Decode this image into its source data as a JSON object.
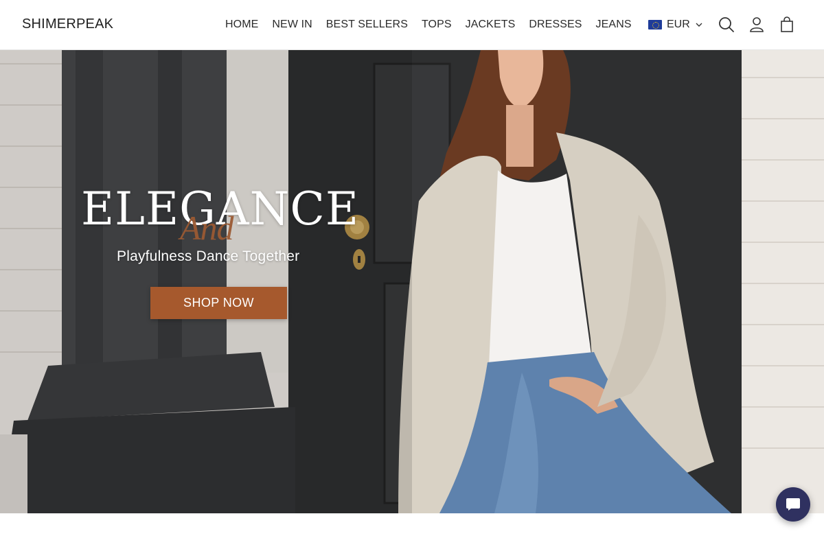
{
  "brand": {
    "logo_text": "SHIMERPEAK"
  },
  "nav": {
    "items": [
      {
        "label": "HOME"
      },
      {
        "label": "NEW IN"
      },
      {
        "label": "BEST SELLERS"
      },
      {
        "label": "TOPS"
      },
      {
        "label": "JACKETS"
      },
      {
        "label": "DRESSES"
      },
      {
        "label": "JEANS"
      }
    ]
  },
  "header_actions": {
    "currency": {
      "code": "EUR",
      "flag_icon": "eu-flag-icon"
    },
    "icons": [
      "search-icon",
      "account-icon",
      "cart-bag-icon"
    ]
  },
  "hero": {
    "headline": "ELEGANCE",
    "script_word": "And",
    "tagline": "Playfulness Dance Together",
    "cta_label": "SHOP NOW"
  },
  "colors": {
    "accent": "#a6592d",
    "chat_button": "#2f3160",
    "header_bg": "#ffffff"
  },
  "chat": {
    "icon": "chat-bubble-icon"
  }
}
